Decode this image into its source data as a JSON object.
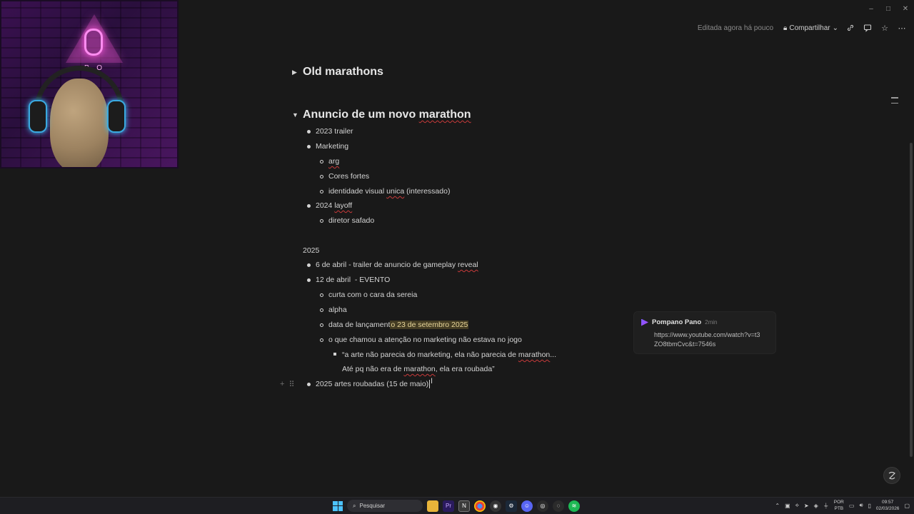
{
  "window": {
    "controls": [
      "–",
      "□",
      "✕"
    ]
  },
  "topbar": {
    "edited": "Editada agora há pouco",
    "share": "Compartilhar"
  },
  "webcam": {
    "neon_text": "P O"
  },
  "toggles": [
    {
      "label": "Old marathons",
      "expanded": false
    },
    {
      "label_pre": "Anuncio de um novo ",
      "label_spell": "marathon",
      "expanded": true
    }
  ],
  "items": {
    "trailer2023": "2023 trailer",
    "marketing": "Marketing",
    "arg": "arg",
    "cores": "Cores fortes",
    "identidade_pre": "identidade visual ",
    "identidade_spell": "unica",
    "identidade_post": " (interessado)",
    "layoff_pre": "2024 ",
    "layoff_spell": "layoff",
    "diretor": "diretor safado",
    "year2025": "2025",
    "abril6_pre": "6 de abril - trailer de anuncio de gameplay ",
    "abril6_spell": "reveal",
    "abril12": "12 de abril  - EVENTO",
    "curta": "curta com o cara da sereia",
    "alpha": "alpha",
    "data_pre": "data de lançament",
    "data_hl": "o 23 de setembro 2025",
    "atencao": "o que chamou a atenção no marketing não estava no jogo",
    "quote1_pre": "“a arte não parecia do marketing, ela não parecia de ",
    "quote1_spell": "marathon",
    "quote1_post": "...",
    "quote2_pre": "Até pq não era de ",
    "quote2_spell": "marathon",
    "quote2_post": ", ela era roubada”",
    "artes": "2025 artes roubadas (15 de maio)"
  },
  "comment": {
    "author": "Pompano Pano",
    "time": "2min",
    "body": "https://www.youtube.com/watch?v=t3ZO8tbmCvc&t=7546s"
  },
  "taskbar": {
    "search_placeholder": "Pesquisar",
    "lang_top": "POR",
    "lang_bottom": "PTB",
    "time": "09:57",
    "date": "02/03/2026"
  }
}
